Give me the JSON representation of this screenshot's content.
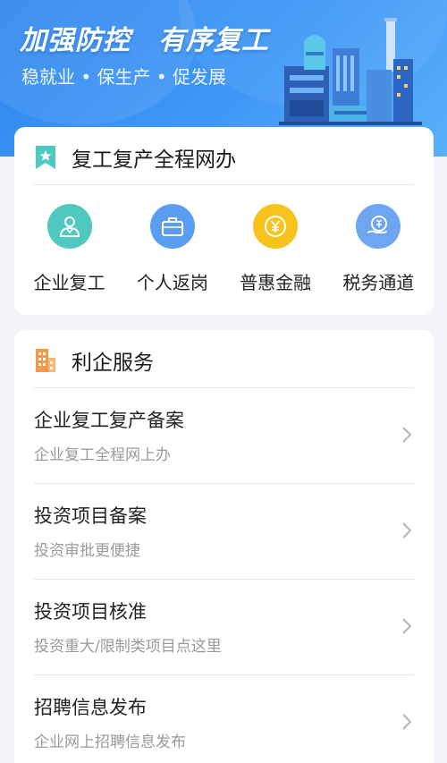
{
  "banner": {
    "title": "加强防控　有序复工",
    "subtitle": "稳就业 • 保生产 • 促发展"
  },
  "online": {
    "title": "复工复产全程网办",
    "items": [
      {
        "label": "企业复工",
        "icon": "worker-icon",
        "color": "#4fc9bf"
      },
      {
        "label": "个人返岗",
        "icon": "briefcase-icon",
        "color": "#5b9df0"
      },
      {
        "label": "普惠金融",
        "icon": "yuan-coin-icon",
        "color": "#f8c21c"
      },
      {
        "label": "税务通道",
        "icon": "tax-hand-icon",
        "color": "#6ea6f2"
      }
    ]
  },
  "services": {
    "title": "利企服务",
    "rows": [
      {
        "title": "企业复工复产备案",
        "desc": "企业复工全程网上办"
      },
      {
        "title": "投资项目备案",
        "desc": "投资审批更便捷"
      },
      {
        "title": "投资项目核准",
        "desc": "投资重大/限制类项目点这里"
      },
      {
        "title": "招聘信息发布",
        "desc": "企业网上招聘信息发布"
      }
    ]
  },
  "colors": {
    "banner": "#3a90f2",
    "star_badge": "#4fc9bf",
    "building_icon": "#f39a4a"
  }
}
